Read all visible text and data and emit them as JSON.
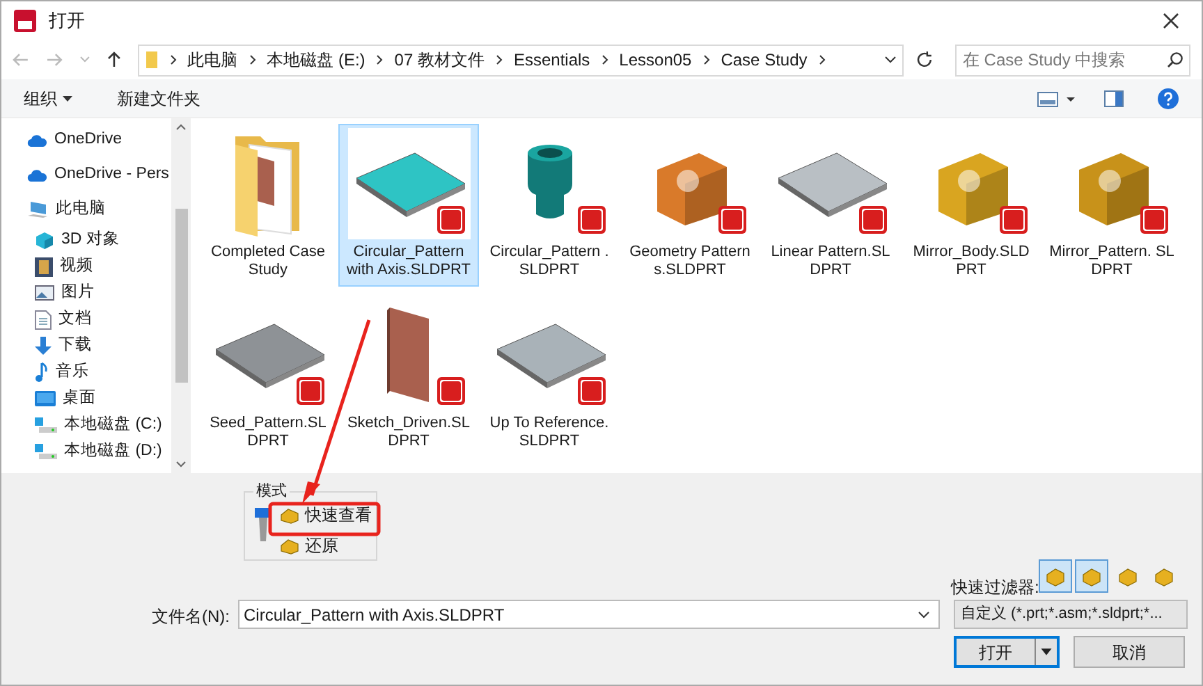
{
  "window": {
    "title": "打开"
  },
  "address": {
    "crumbs": [
      "此电脑",
      "本地磁盘 (E:)",
      "07 教材文件",
      "Essentials",
      "Lesson05",
      "Case Study"
    ]
  },
  "search": {
    "placeholder": "在 Case Study 中搜索"
  },
  "toolbar": {
    "organize": "组织",
    "new_folder": "新建文件夹"
  },
  "sidebar": {
    "items": [
      {
        "label": "OneDrive",
        "kind": "cloud"
      },
      {
        "label": "OneDrive - Pers",
        "kind": "cloud"
      },
      {
        "label": "此电脑",
        "kind": "pc",
        "children": [
          {
            "label": "3D 对象",
            "kind": "cube"
          },
          {
            "label": "视频",
            "kind": "video"
          },
          {
            "label": "图片",
            "kind": "picture"
          },
          {
            "label": "文档",
            "kind": "doc"
          },
          {
            "label": "下载",
            "kind": "download"
          },
          {
            "label": "音乐",
            "kind": "music"
          },
          {
            "label": "桌面",
            "kind": "desktop"
          },
          {
            "label": "本地磁盘 (C:)",
            "kind": "drive"
          },
          {
            "label": "本地磁盘 (D:)",
            "kind": "drive"
          }
        ]
      }
    ]
  },
  "files": [
    {
      "name": "Completed Case Study",
      "kind": "folder",
      "selected": false
    },
    {
      "name": "Circular_Pattern with Axis.SLDPRT",
      "kind": "plate",
      "color": "#2ec4c4",
      "selected": true
    },
    {
      "name": "Circular_Pattern .SLDPRT",
      "kind": "cylinder",
      "color": "#127a78",
      "selected": false
    },
    {
      "name": "Geometry Patterns.SLDPRT",
      "kind": "block",
      "color": "#d97a2a",
      "selected": false
    },
    {
      "name": "Linear Pattern.SLDPRT",
      "kind": "plate",
      "color": "#b9bfc4",
      "selected": false
    },
    {
      "name": "Mirror_Body.SLDPRT",
      "kind": "block",
      "color": "#d9a520",
      "selected": false
    },
    {
      "name": "Mirror_Pattern. SLDPRT",
      "kind": "block",
      "color": "#c8921a",
      "selected": false
    },
    {
      "name": "Seed_Pattern.SLDPRT",
      "kind": "plate",
      "color": "#8e9296",
      "selected": false
    },
    {
      "name": "Sketch_Driven.SLDPRT",
      "kind": "panel",
      "color": "#a9604e",
      "selected": false
    },
    {
      "name": "Up To Reference.SLDPRT",
      "kind": "plate",
      "color": "#a9b2b8",
      "selected": false
    }
  ],
  "mode": {
    "title": "模式",
    "options": [
      "快速查看",
      "还原"
    ]
  },
  "quick_filter": {
    "label": "快速过滤器:",
    "buttons": [
      {
        "selected": true
      },
      {
        "selected": true
      },
      {
        "selected": false
      },
      {
        "selected": false
      }
    ]
  },
  "file_name": {
    "label": "文件名(N):",
    "value": "Circular_Pattern with Axis.SLDPRT"
  },
  "file_type": {
    "value": "自定义 (*.prt;*.asm;*.sldprt;*..."
  },
  "buttons": {
    "open": "打开",
    "cancel": "取消"
  }
}
